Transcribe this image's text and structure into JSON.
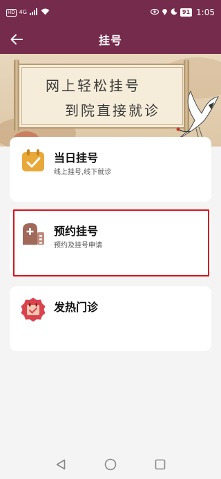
{
  "status_bar": {
    "hd_badge": "HD",
    "network": "4G",
    "battery": "91",
    "time": "1:05"
  },
  "header": {
    "title": "挂号",
    "back_icon": "back-arrow-icon"
  },
  "banner": {
    "line1": "网上轻松挂号",
    "line2": "到院直接就诊"
  },
  "cards": [
    {
      "title": "当日挂号",
      "subtitle": "线上挂号,线下就诊",
      "icon": "calendar-check-icon",
      "icon_color": "#e8a83a"
    },
    {
      "title": "预约挂号",
      "subtitle": "预约及挂号申请",
      "icon": "hospital-building-icon",
      "icon_color": "#a0695a"
    },
    {
      "title": "发热门诊",
      "subtitle": "",
      "icon": "fever-calendar-icon",
      "icon_color": "#d9434e"
    }
  ],
  "colors": {
    "primary": "#752c4c",
    "highlight_border": "#d8111c"
  }
}
